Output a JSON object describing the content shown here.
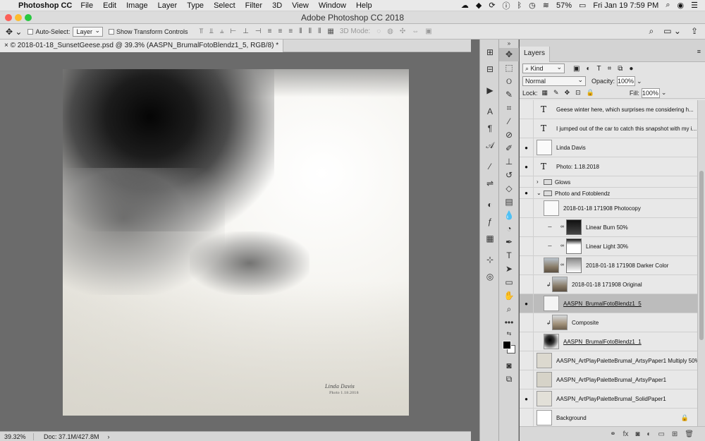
{
  "menubar": {
    "app_name": "Photoshop CC",
    "items": [
      "File",
      "Edit",
      "Image",
      "Layer",
      "Type",
      "Select",
      "Filter",
      "3D",
      "View",
      "Window",
      "Help"
    ],
    "battery": "57%",
    "clock": "Fri Jan 19  7:59 PM"
  },
  "window": {
    "title": "Adobe Photoshop CC 2018"
  },
  "options": {
    "auto_select_label": "Auto-Select:",
    "auto_select_value": "Layer",
    "show_transform_label": "Show Transform Controls",
    "mode_label": "3D Mode:"
  },
  "document": {
    "tab_title": "© 2018-01-18_SunsetGeese.psd @ 39.3% (AASPN_BrumalFotoBlendz1_5, RGB/8) *",
    "signature": "Linda Davis",
    "photo_date": "Photo 1.18.2018"
  },
  "status": {
    "zoom": "39.32%",
    "doc": "Doc: 37.1M/427.8M",
    "arrow": "›"
  },
  "layers_panel": {
    "tab": "Layers",
    "kind_filter": "Kind",
    "blend_mode": "Normal",
    "opacity_label": "Opacity:",
    "opacity": "100%",
    "lock_label": "Lock:",
    "fill_label": "Fill:",
    "fill": "100%",
    "layers": [
      {
        "name": "Geese winter here,    which surprises me considering h..."
      },
      {
        "name": "I jumped out of the car to catch this snapshot with my i..."
      },
      {
        "name": "Linda Davis"
      },
      {
        "name": "Photo: 1.18.2018"
      },
      {
        "name": "Glows"
      },
      {
        "name": "Photo and Fotoblendz"
      },
      {
        "name": "2018-01-18 171908 Photocopy"
      },
      {
        "name": "Linear Burn 50%"
      },
      {
        "name": "Linear Light 30%"
      },
      {
        "name": "2018-01-18 171908 Darker Color"
      },
      {
        "name": "2018-01-18 171908 Original"
      },
      {
        "name": "AASPN_BrumalFotoBlendz1_5"
      },
      {
        "name": "Composite"
      },
      {
        "name": "AASPN_BrumalFotoBlendz1_1"
      },
      {
        "name": "AASPN_ArtPlayPaletteBrumal_ArtsyPaper1 Multiply 50%"
      },
      {
        "name": "AASPN_ArtPlayPaletteBrumal_ArtsyPaper1"
      },
      {
        "name": "AASPN_ArtPlayPaletteBrumal_SolidPaper1"
      },
      {
        "name": "Background"
      }
    ]
  }
}
